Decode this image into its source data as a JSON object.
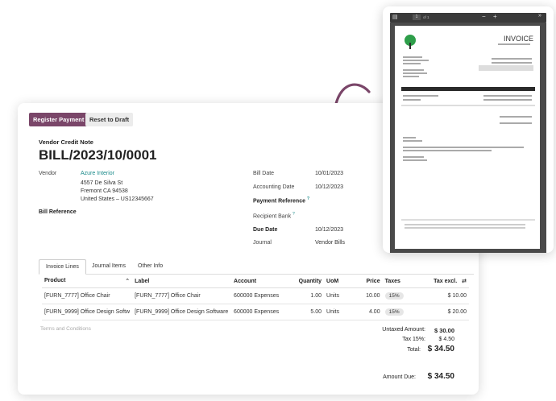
{
  "toolbar": {
    "register_payment": "Register Payment",
    "reset_draft": "Reset to Draft"
  },
  "doc": {
    "type_label": "Vendor Credit Note",
    "title": "BILL/2023/10/0001"
  },
  "vendor": {
    "label": "Vendor",
    "name": "Azure Interior",
    "street": "4557 De Silva St",
    "city": "Fremont CA 94538",
    "country_vat": "United States – US12345667"
  },
  "bill_reference_label": "Bill Reference",
  "right_fields": {
    "bill_date_label": "Bill Date",
    "bill_date": "10/01/2023",
    "accounting_date_label": "Accounting Date",
    "accounting_date": "10/12/2023",
    "payment_reference_label": "Payment Reference",
    "recipient_bank_label": "Recipient Bank",
    "due_date_label": "Due Date",
    "due_date": "10/12/2023",
    "journal_label": "Journal",
    "journal": "Vendor Bills",
    "help_mark": "?"
  },
  "tabs": [
    {
      "label": "Invoice Lines"
    },
    {
      "label": "Journal Items"
    },
    {
      "label": "Other Info"
    }
  ],
  "table": {
    "headers": {
      "product": "Product",
      "label": "Label",
      "account": "Account",
      "quantity": "Quantity",
      "uom": "UoM",
      "price": "Price",
      "taxes": "Taxes",
      "tax_excl": "Tax excl."
    },
    "rows": [
      {
        "product": "[FURN_7777] Office Chair",
        "label": "[FURN_7777] Office Chair",
        "account": "600000 Expenses",
        "quantity": "1.00",
        "uom": "Units",
        "price": "10.00",
        "taxes": "15%",
        "tax_excl": "$ 10.00"
      },
      {
        "product": "[FURN_9999] Office Design Softw",
        "label": "[FURN_9999] Office Design Software",
        "account": "600000 Expenses",
        "quantity": "5.00",
        "uom": "Units",
        "price": "4.00",
        "taxes": "15%",
        "tax_excl": "$ 20.00"
      }
    ]
  },
  "terms_placeholder": "Terms and Conditions",
  "totals": {
    "untaxed_label": "Untaxed Amount:",
    "untaxed": "$ 30.00",
    "tax_label": "Tax 15%:",
    "tax": "$ 4.50",
    "total_label": "Total:",
    "total": "$ 34.50",
    "amount_due_label": "Amount Due:",
    "amount_due": "$ 34.50"
  },
  "invoice_preview": {
    "title": "INVOICE",
    "pdf_page": "1",
    "pdf_pages_suffix": "of 1",
    "colors": {
      "accent": "#7a4669",
      "link": "#1a8a8a",
      "arrow": "#7a4669"
    }
  },
  "icons": [
    "sidebar-toggle-icon",
    "zoom-out-icon",
    "zoom-in-icon",
    "more-icon",
    "sort-up-icon",
    "column-settings-icon",
    "curved-arrow-icon",
    "tree-logo-icon"
  ]
}
